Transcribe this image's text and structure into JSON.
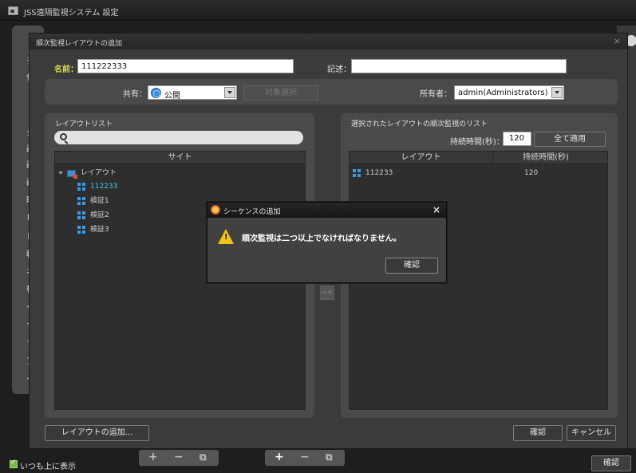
{
  "app": {
    "title": "JSS遠隔監視システム 設定",
    "sidebar_chars": [
      "テ",
      "仕",
      "",
      "シ",
      "画",
      "画",
      "画",
      "晴",
      "ビ",
      "し",
      "軸",
      "ネ",
      "根",
      "サ",
      "マ",
      "フ",
      "ア",
      "イ"
    ],
    "pin_label": "いつも上に表示",
    "pin_checked": true,
    "ok_label": "確認",
    "bottom_group1": [
      "+",
      "−",
      "⧉"
    ],
    "bottom_group2": [
      "+",
      "−",
      "⧉"
    ]
  },
  "dialog": {
    "title": "順次監視レイアウトの追加",
    "close_label": "×",
    "name_label": "名前：",
    "name_value": "111222333",
    "desc_label": "記述：",
    "desc_value": "",
    "share_label": "共有：",
    "share_value": "公開",
    "target_select_label": "対象選択",
    "owner_label": "所有者：",
    "owner_value": "admin(Administrators)",
    "transfer_label": "<<",
    "add_layout_label": "レイアウトの追加...",
    "ok_label": "確認",
    "cancel_label": "キャンセル"
  },
  "layout_list": {
    "title": "レイアウトリスト",
    "search_placeholder": "",
    "column_header": "サイト",
    "root_label": "レイアウト",
    "items": [
      {
        "label": "112233",
        "selected": true
      },
      {
        "label": "検証1",
        "selected": false
      },
      {
        "label": "検証2",
        "selected": false
      },
      {
        "label": "検証3",
        "selected": false
      }
    ]
  },
  "selected_list": {
    "title": "選択されたレイアウトの順次監視のリスト",
    "duration_label": "持続時間(秒)：",
    "duration_value": "120",
    "apply_all_label": "全て適用",
    "columns": [
      "レイアウト",
      "持続時間(秒)"
    ],
    "rows": [
      {
        "layout": "112233",
        "duration": "120"
      }
    ]
  },
  "alert": {
    "title": "シーケンスの追加",
    "close_label": "×",
    "warning_mark": "!",
    "message": "順次監視は二つ以上でなければなりません。",
    "ok_label": "確認"
  },
  "colors": {
    "accent_label": "#d9e14a",
    "selected_item": "#45c4e5",
    "warning": "#f4c313",
    "window_bg": "#3b3b3b",
    "panel_bg": "#4a4a4a"
  }
}
